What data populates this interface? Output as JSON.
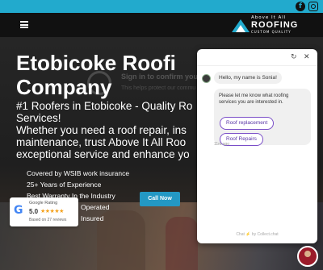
{
  "header": {
    "logo_line1": "Above It All",
    "logo_line2": "ROOFING",
    "logo_line3": "CUSTOM QUALITY"
  },
  "hero": {
    "title_line1": "Etobicoke Roofi",
    "title_line2": "Company",
    "subtitle_lines": [
      "#1 Roofers in Etobicoke - Quality Ro",
      "Services!",
      "Whether you need a roof repair, ins",
      "maintenance, trust Above It All Roo",
      "exceptional service and enhance yo"
    ],
    "ghost_text": "Sign in to confirm you're",
    "ghost_sub": "This helps protect our commu",
    "bullets": [
      "Covered by WSIB work insurance",
      "25+ Years of Experience",
      "Best Warranty In the Industry",
      "Operated",
      "Insured"
    ],
    "call_button": "Call Now"
  },
  "google": {
    "label": "Google Rating",
    "rating": "5.0",
    "stars": "★★★★★",
    "based_on": "Based on 27 reviews"
  },
  "chat": {
    "greeting": "Hello, my name is Sonia!",
    "prompt": "Please let me know what roofing services you are interested in.",
    "options": [
      "Roof replacement",
      "Roof Repairs"
    ],
    "time": "11m ago",
    "powered": "Chat ⚡ by Collect.chat"
  },
  "colors": {
    "topbar": "#22aacd",
    "call_button": "#2398c4",
    "chat_option_border": "#7a4ec8"
  }
}
